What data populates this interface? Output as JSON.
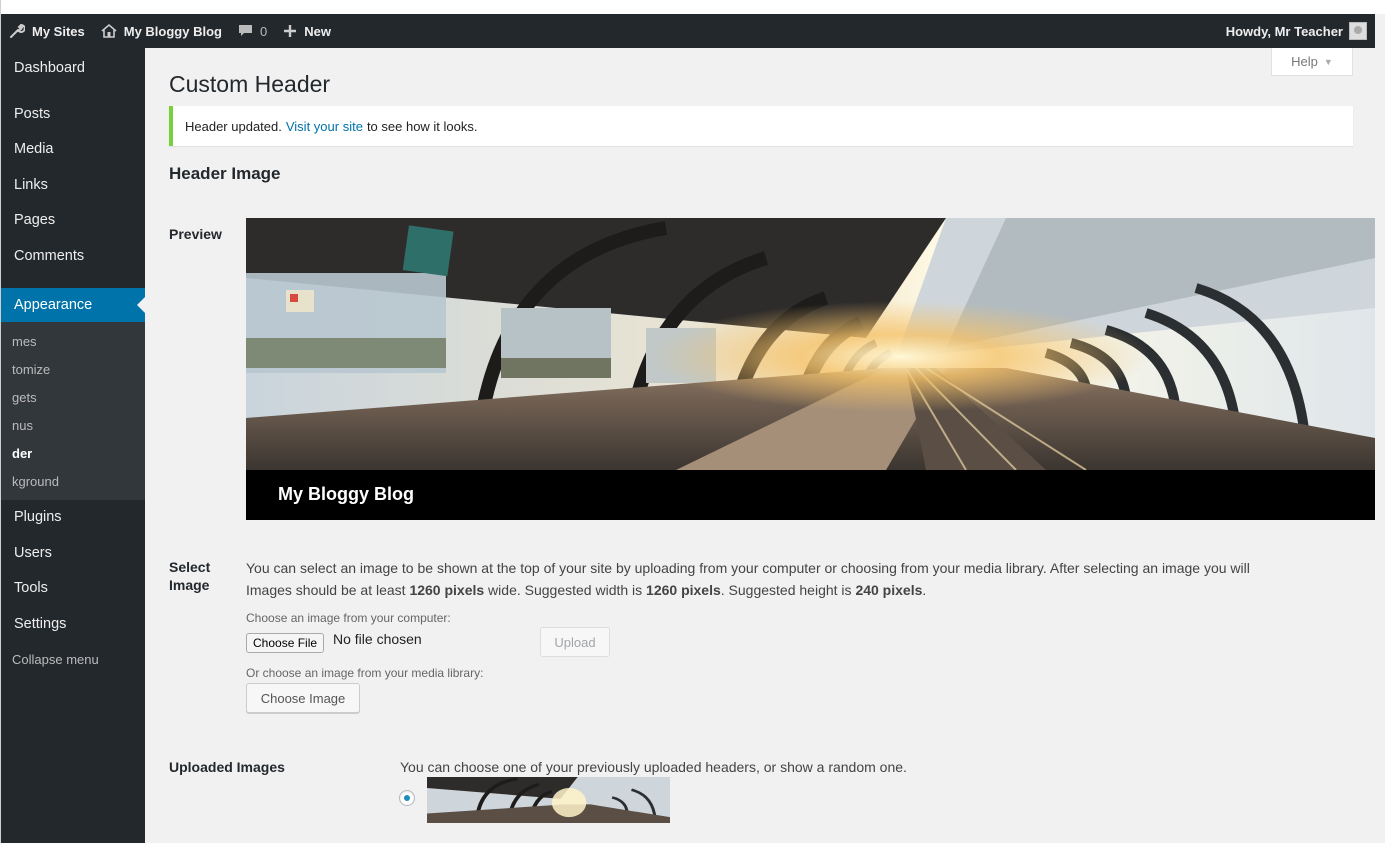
{
  "admin_bar": {
    "my_sites": "My Sites",
    "site_name": "My Bloggy Blog",
    "comments_count": "0",
    "new_label": "New",
    "greeting": "Howdy, Mr Teacher"
  },
  "sidebar": {
    "items": [
      {
        "label": "Dashboard"
      },
      {
        "label": "Posts"
      },
      {
        "label": "Media"
      },
      {
        "label": "Links"
      },
      {
        "label": "Pages"
      },
      {
        "label": "Comments"
      },
      {
        "label": "Appearance"
      }
    ],
    "submenu": [
      "mes",
      "tomize",
      "gets",
      "nus",
      "der",
      "kground"
    ],
    "items_after": [
      {
        "label": "Plugins"
      },
      {
        "label": "Users"
      },
      {
        "label": "Tools"
      },
      {
        "label": "Settings"
      }
    ],
    "collapse": "Collapse menu"
  },
  "help_tab": "Help",
  "page_title": "Custom Header",
  "notice": {
    "before": "Header updated.",
    "link": "Visit your site",
    "after": "to see how it looks."
  },
  "section_title": "Header Image",
  "preview": {
    "label": "Preview",
    "blog_title": "My Bloggy Blog"
  },
  "select_image": {
    "label_line1": "Select",
    "label_line2": "Image",
    "desc1": "You can select an image to be shown at the top of your site by uploading from your computer or choosing from your media library. After selecting an image you will",
    "desc2_a": "Images should be at least ",
    "desc2_b": "1260 pixels",
    "desc2_c": " wide. Suggested width is ",
    "desc2_d": "1260 pixels",
    "desc2_e": ". Suggested height is ",
    "desc2_f": "240 pixels",
    "desc2_g": ".",
    "choose_from_computer": "Choose an image from your computer:",
    "choose_file_button": "Choose File",
    "no_file": "No file chosen",
    "upload_button": "Upload",
    "choose_from_library": "Or choose an image from your media library:",
    "choose_image_button": "Choose Image"
  },
  "uploaded_images": {
    "label": "Uploaded Images",
    "desc": "You can choose one of your previously uploaded headers, or show a random one."
  },
  "colors": {
    "admin_bar": "#23282d",
    "sidebar": "#23282d",
    "current_menu": "#0073aa",
    "notice_border": "#7ad03a",
    "link": "#0073aa"
  }
}
